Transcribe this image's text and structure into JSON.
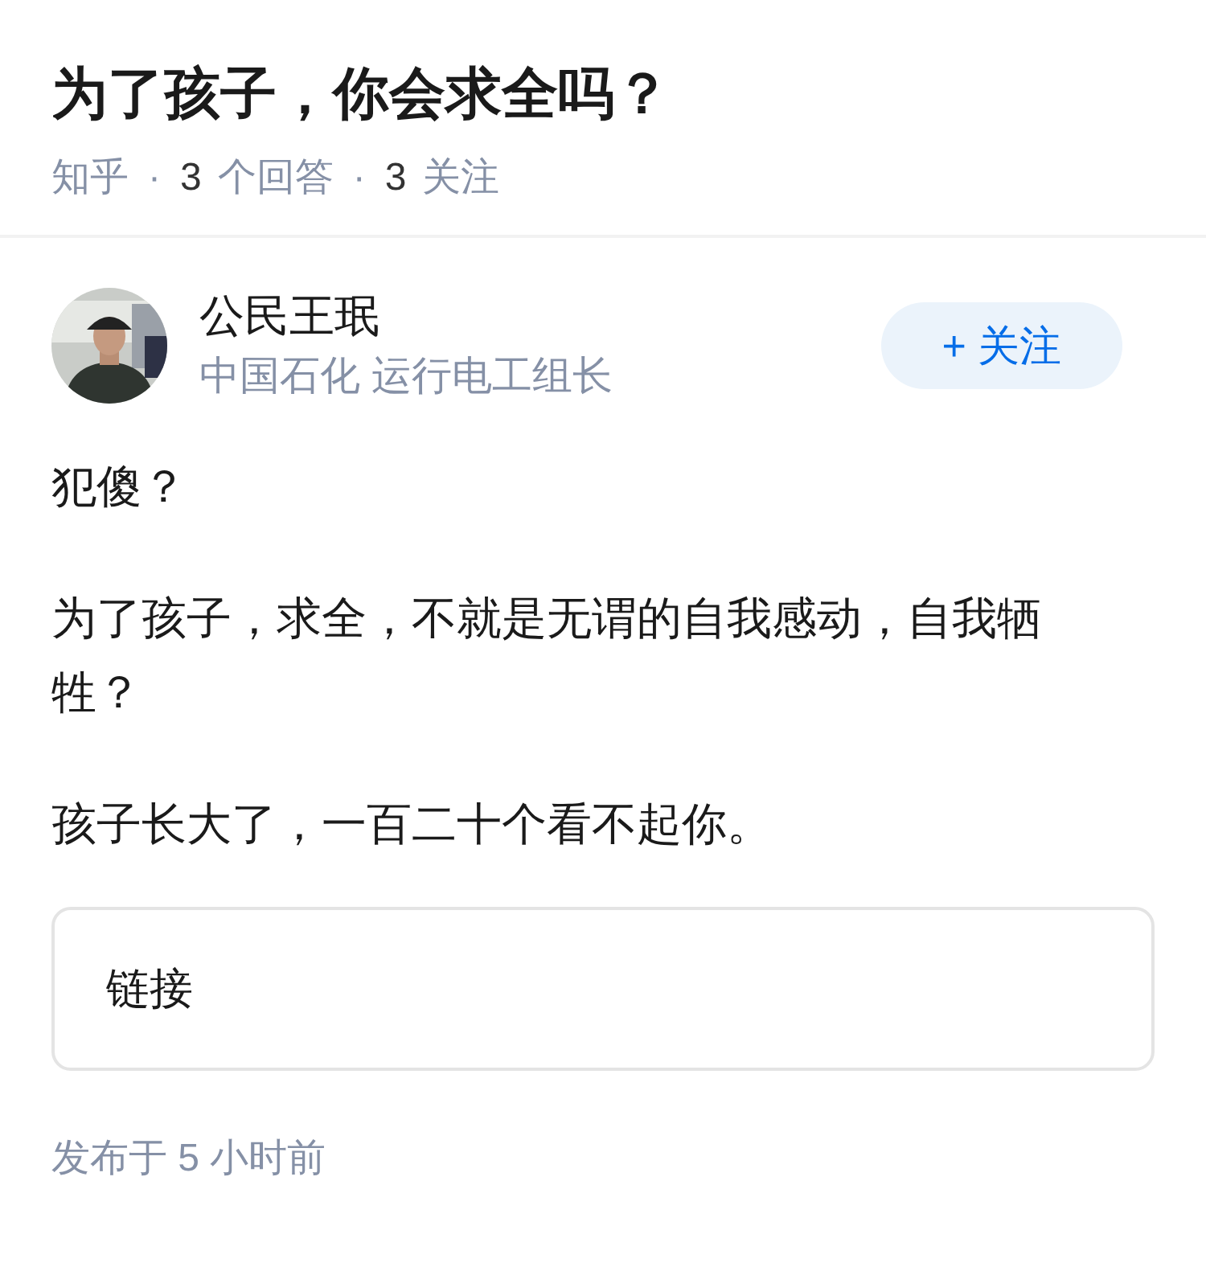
{
  "question": {
    "title": "为了孩子，你会求全吗？",
    "source": "知乎",
    "separator": "·",
    "answer_count": "3",
    "answer_label": "个回答",
    "follow_count": "3",
    "follow_label": "关注"
  },
  "answer": {
    "author": {
      "name": "公民王珉",
      "headline": "中国石化 运行电工组长"
    },
    "follow_button": "+ 关注",
    "paragraphs": [
      "犯傻？",
      "为了孩子，求全，不就是无谓的自我感动，自我牺牲？",
      "孩子长大了，一百二十个看不起你。"
    ],
    "link_card": "链接",
    "published": "发布于 5 小时前"
  }
}
